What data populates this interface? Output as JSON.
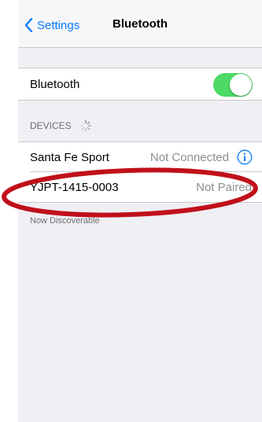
{
  "nav": {
    "back_label": "Settings",
    "title": "Bluetooth"
  },
  "bluetooth_row": {
    "label": "Bluetooth",
    "toggle_on": true
  },
  "devices_header": "DEVICES",
  "devices": [
    {
      "name": "Santa Fe Sport",
      "status": "Not Connected"
    },
    {
      "name": "YJPT-1415-0003",
      "status": "Not Paired"
    }
  ],
  "discoverable_text": "Now Discoverable",
  "colors": {
    "accent": "#0a7aff",
    "toggle_on": "#4cd964",
    "annotation": "#c0101a"
  }
}
